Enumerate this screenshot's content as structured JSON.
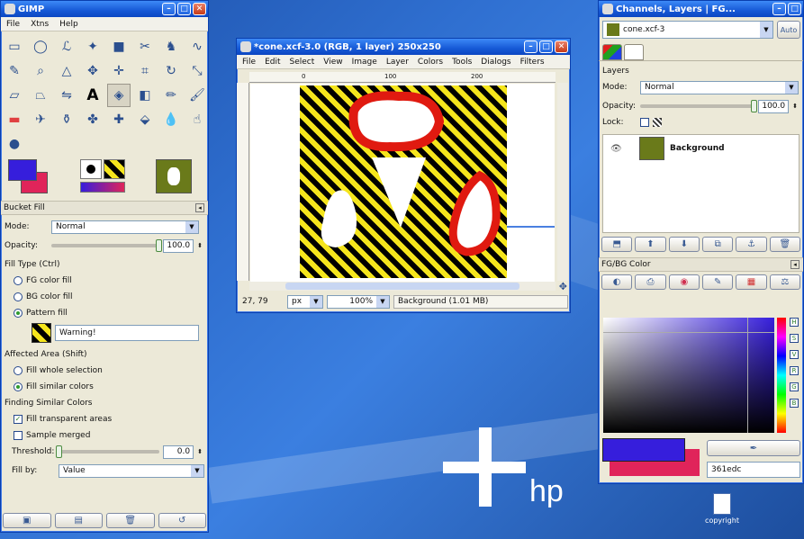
{
  "toolbox": {
    "title": "GIMP",
    "menu": [
      "File",
      "Xtns",
      "Help"
    ],
    "tool_options_title": "Bucket Fill",
    "mode_label": "Mode:",
    "mode_value": "Normal",
    "opacity_label": "Opacity:",
    "opacity_value": "100.0",
    "opacity_fraction": 1.0,
    "fill_type_label": "Fill Type  (Ctrl)",
    "fill_fg": "FG color fill",
    "fill_bg": "BG color fill",
    "fill_pattern": "Pattern fill",
    "pattern_name": "Warning!",
    "affected_label": "Affected Area  (Shift)",
    "affect_whole": "Fill whole selection",
    "affect_similar": "Fill similar colors",
    "finding_label": "Finding Similar Colors",
    "fill_transparent": "Fill transparent areas",
    "sample_merged": "Sample merged",
    "threshold_label": "Threshold:",
    "threshold_value": "0.0",
    "threshold_fraction": 0.0,
    "fillby_label": "Fill by:",
    "fillby_value": "Value"
  },
  "image_window": {
    "title": "*cone.xcf-3.0 (RGB, 1 layer) 250x250",
    "menu": [
      "File",
      "Edit",
      "Select",
      "View",
      "Image",
      "Layer",
      "Colors",
      "Tools",
      "Dialogs",
      "Filters"
    ],
    "ruler_marks": [
      "0",
      "100",
      "200"
    ],
    "coords": "27, 79",
    "unit": "px",
    "zoom": "100%",
    "status": "Background (1.01 MB)"
  },
  "dock": {
    "title": "Channels, Layers | FG...",
    "image_combo": "cone.xcf-3",
    "auto_label": "Auto",
    "layers_title": "Layers",
    "mode_label": "Mode:",
    "mode_value": "Normal",
    "opacity_label": "Opacity:",
    "opacity_value": "100.0",
    "opacity_fraction": 1.0,
    "lock_label": "Lock:",
    "layer_name": "Background",
    "fgbg_title": "FG/BG Color",
    "hex_value": "361edc"
  },
  "desktop": {
    "brand": "hp",
    "icon_label": "copyright"
  },
  "colors": {
    "fg": "#361edc",
    "bg": "#e0245a",
    "accent_red": "#e01a10"
  }
}
